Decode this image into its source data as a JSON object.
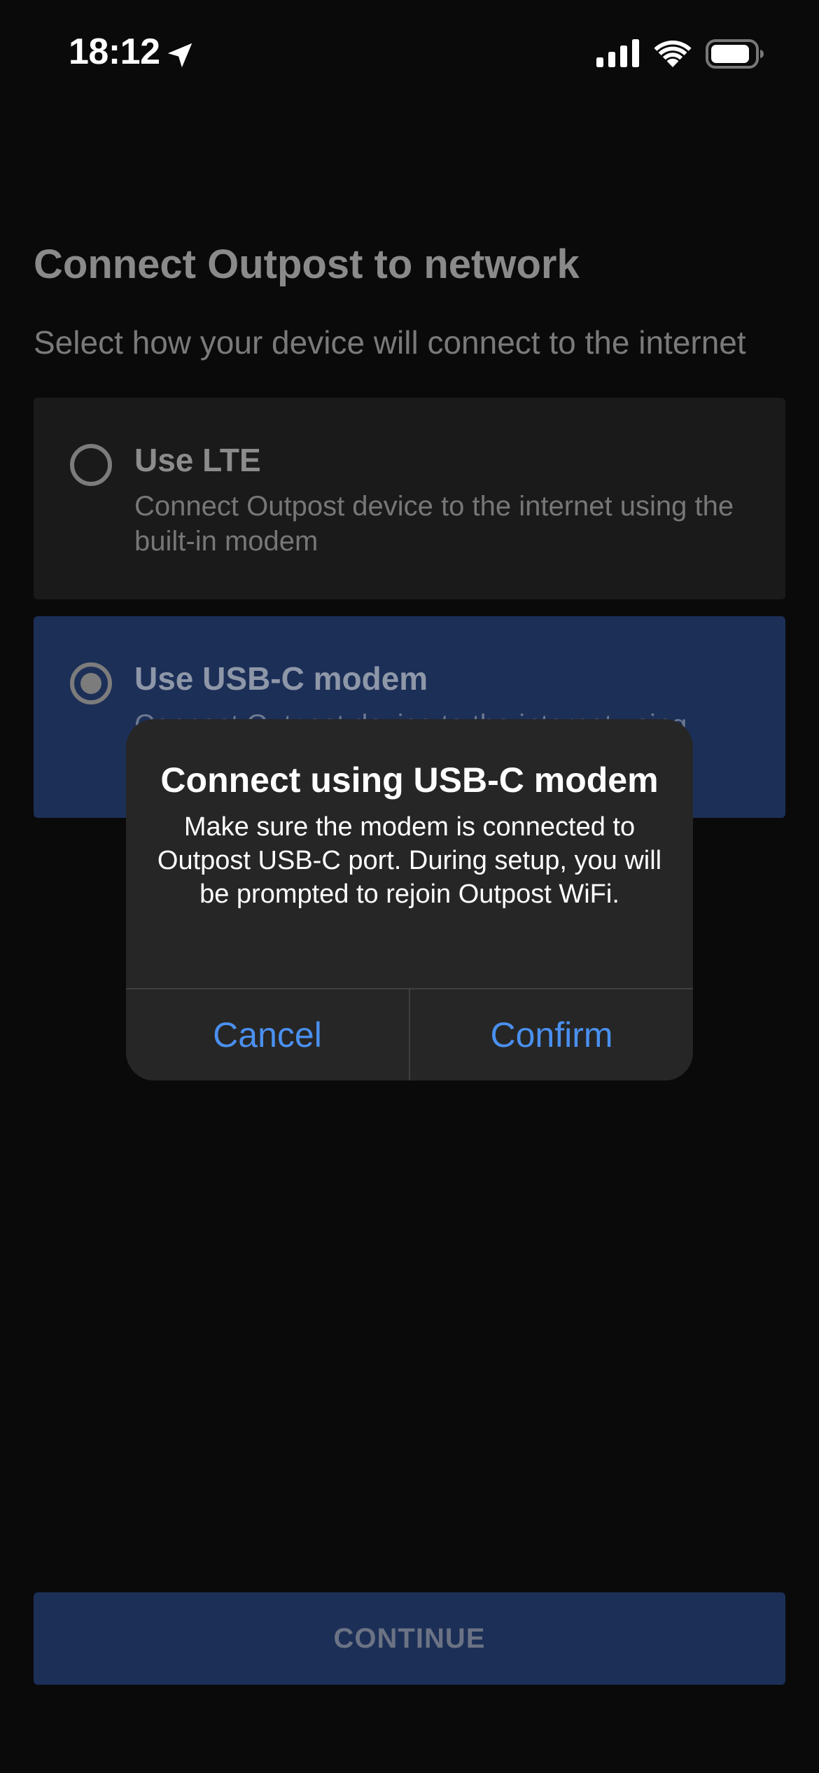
{
  "status_bar": {
    "time": "18:12",
    "icons": [
      "location-arrow-icon",
      "cellular-signal-icon",
      "wifi-icon",
      "battery-icon"
    ]
  },
  "page": {
    "title": "Connect Outpost to network",
    "subtitle": "Select how your device will connect to the internet"
  },
  "options": [
    {
      "title": "Use LTE",
      "description": "Connect Outpost device to the internet using the built-in modem",
      "selected": false
    },
    {
      "title": "Use USB-C modem",
      "description": "Connect Outpost device to the internet using",
      "selected": true
    }
  ],
  "continue_button": {
    "label": "CONTINUE"
  },
  "alert": {
    "title": "Connect using USB-C modem",
    "message": "Make sure the modem is connected to Outpost USB-C port. During setup, you will be prompted to rejoin Outpost WiFi.",
    "cancel_label": "Cancel",
    "confirm_label": "Confirm"
  },
  "colors": {
    "background": "#0a0a0a",
    "card_unselected": "#1a1a1a",
    "card_selected": "#1c2f57",
    "alert_background": "#262626",
    "alert_button_text": "#4a90f0"
  }
}
